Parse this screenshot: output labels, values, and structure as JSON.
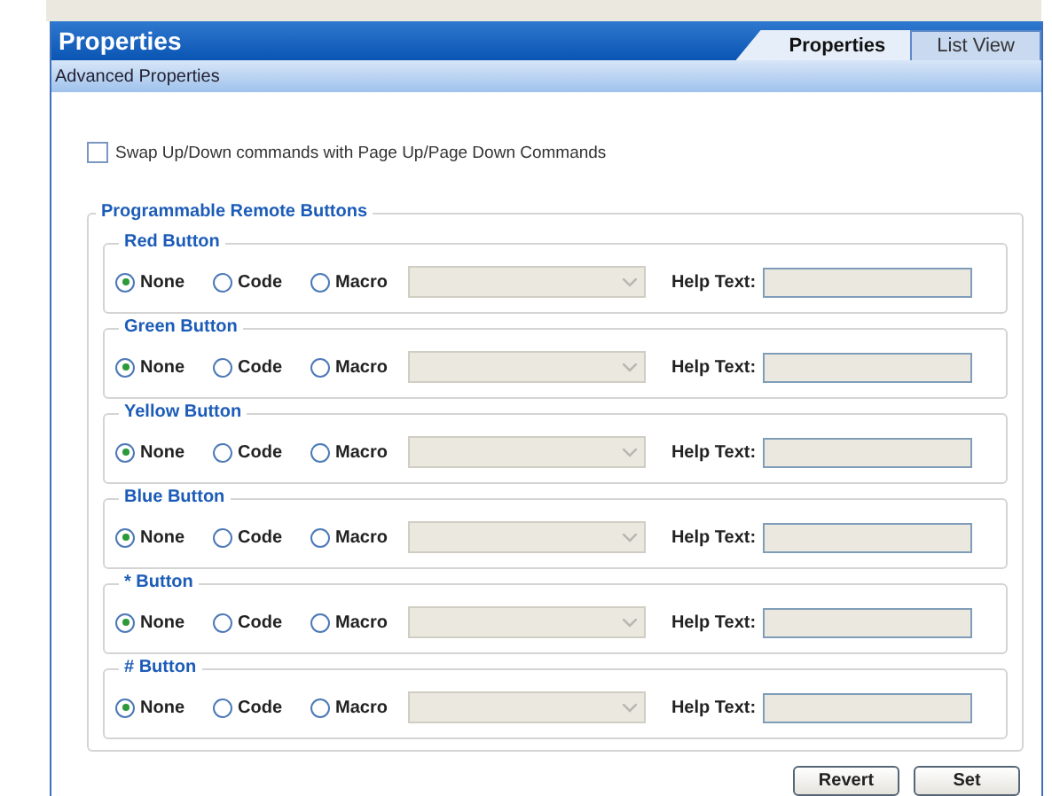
{
  "window": {
    "title": "Properties"
  },
  "tabs": [
    {
      "label": "Properties",
      "selected": true
    },
    {
      "label": "List View",
      "selected": false
    }
  ],
  "subheader": "Advanced Properties",
  "swap_option": {
    "label": "Swap Up/Down commands with Page Up/Page Down Commands",
    "checked": false
  },
  "remote_section": {
    "title": "Programmable Remote Buttons",
    "groups": [
      {
        "title": "Red Button",
        "options": [
          {
            "label": "None",
            "selected": true
          },
          {
            "label": "Code",
            "selected": false
          },
          {
            "label": "Macro",
            "selected": false
          }
        ],
        "dropdown_disabled": true,
        "help_label": "Help Text:",
        "help_disabled": true
      },
      {
        "title": "Green Button",
        "options": [
          {
            "label": "None",
            "selected": true
          },
          {
            "label": "Code",
            "selected": false
          },
          {
            "label": "Macro",
            "selected": false
          }
        ],
        "dropdown_disabled": true,
        "help_label": "Help Text:",
        "help_disabled": true
      },
      {
        "title": "Yellow Button",
        "options": [
          {
            "label": "None",
            "selected": true
          },
          {
            "label": "Code",
            "selected": false
          },
          {
            "label": "Macro",
            "selected": false
          }
        ],
        "dropdown_disabled": true,
        "help_label": "Help Text:",
        "help_disabled": true
      },
      {
        "title": "Blue Button",
        "options": [
          {
            "label": "None",
            "selected": true
          },
          {
            "label": "Code",
            "selected": false
          },
          {
            "label": "Macro",
            "selected": false
          }
        ],
        "dropdown_disabled": true,
        "help_label": "Help Text:",
        "help_disabled": true
      },
      {
        "title": "* Button",
        "options": [
          {
            "label": "None",
            "selected": true
          },
          {
            "label": "Code",
            "selected": false
          },
          {
            "label": "Macro",
            "selected": false
          }
        ],
        "dropdown_disabled": true,
        "help_label": "Help Text:",
        "help_disabled": true
      },
      {
        "title": "# Button",
        "options": [
          {
            "label": "None",
            "selected": true
          },
          {
            "label": "Code",
            "selected": false
          },
          {
            "label": "Macro",
            "selected": false
          }
        ],
        "dropdown_disabled": true,
        "help_label": "Help Text:",
        "help_disabled": true
      }
    ]
  },
  "buttons": [
    "Revert",
    "Set"
  ]
}
